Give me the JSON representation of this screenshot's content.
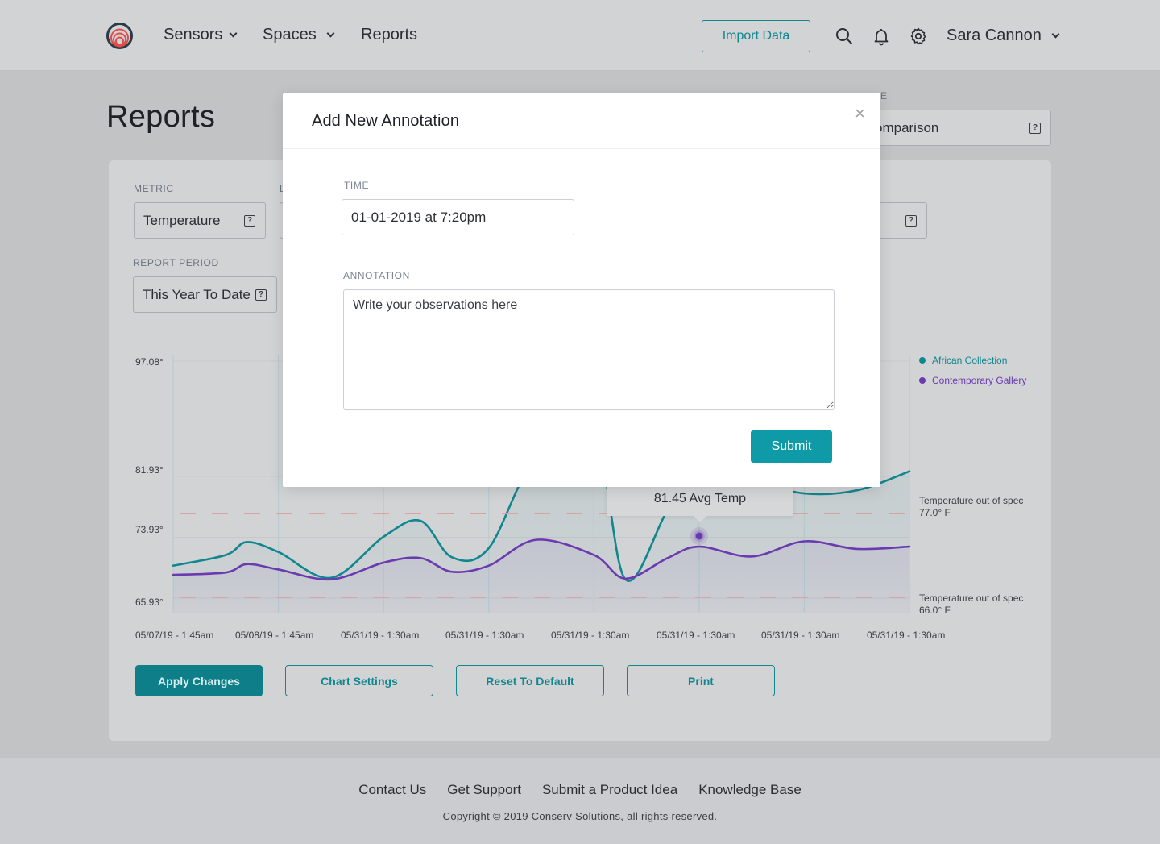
{
  "header": {
    "nav": [
      {
        "label": "Sensors",
        "has_dropdown": true
      },
      {
        "label": "Spaces",
        "has_dropdown": true
      },
      {
        "label": "Reports",
        "has_dropdown": false
      }
    ],
    "import_label": "Import Data",
    "icons": [
      "search-icon",
      "bell-icon",
      "gear-icon"
    ],
    "user_name": "Sara Cannon"
  },
  "page": {
    "title": "Reports",
    "type_label_partial": "E",
    "type_value_partial": "omparison",
    "metric_label": "METRIC",
    "metric_value": "Temperature",
    "location_label_partial": "L",
    "report_period_label": "REPORT PERIOD",
    "report_period_value": "This Year To Date",
    "help_glyph": "?"
  },
  "chart_data": {
    "type": "line",
    "title": "",
    "xlabel": "",
    "ylabel": "",
    "y_ticks": [
      "97.08°",
      "81.93°",
      "73.93°",
      "65.93°"
    ],
    "ylim": [
      65.93,
      97.08
    ],
    "x_ticks": [
      "05/07/19 - 1:45am",
      "05/08/19 - 1:45am",
      "05/31/19 - 1:30am",
      "05/31/19 - 1:30am",
      "05/31/19 - 1:30am",
      "05/31/19 - 1:30am",
      "05/31/19 - 1:30am",
      "05/31/19 - 1:30am"
    ],
    "x": [
      0,
      0.5,
      0.7,
      1,
      1.5,
      2,
      2.35,
      2.65,
      3,
      3.45,
      4,
      4.3,
      4.7,
      5,
      5.5,
      6,
      6.5,
      7
    ],
    "series": [
      {
        "name": "African Collection",
        "color": "#10868f",
        "values": [
          70.2,
          71.6,
          73.3,
          72.0,
          68.6,
          74.0,
          76.1,
          71.3,
          72.5,
          84.5,
          87.2,
          68.4,
          77.5,
          83.0,
          81.4,
          79.7,
          80.1,
          82.6
        ]
      },
      {
        "name": "Contemporary Gallery",
        "color": "#6a3ab0",
        "values": [
          69.0,
          69.3,
          70.4,
          69.7,
          68.4,
          70.6,
          71.2,
          69.4,
          70.2,
          73.6,
          71.6,
          68.5,
          71.2,
          72.7,
          71.4,
          73.4,
          72.4,
          72.7
        ]
      }
    ],
    "thresholds": [
      {
        "label": "Temperature out of spec",
        "value_label": "77.0° F",
        "value": 77.0
      },
      {
        "label": "Temperature out of spec",
        "value_label": "66.0° F",
        "value": 66.0
      }
    ],
    "legend_position": "top-right",
    "tooltip": {
      "text": "81.45 Avg Temp",
      "series": "Contemporary Gallery",
      "x_index": 5
    }
  },
  "actions": {
    "apply": "Apply Changes",
    "chart_settings": "Chart Settings",
    "reset": "Reset To Default",
    "print": "Print"
  },
  "footer": {
    "links": [
      "Contact Us",
      "Get Support",
      "Submit a Product Idea",
      "Knowledge Base"
    ],
    "copyright": "Copyright © 2019 Conserv Solutions, all rights reserved."
  },
  "modal": {
    "title": "Add New Annotation",
    "close_glyph": "×",
    "time_label": "TIME",
    "time_value": "01-01-2019 at 7:20pm",
    "annotation_label": "ANNOTATION",
    "annotation_placeholder": "Write your observations here",
    "submit_label": "Submit"
  },
  "colors": {
    "accent": "#10868f",
    "submit": "#0e9aa6",
    "series_a": "#10868f",
    "series_b": "#6a3ab0",
    "threshold": "#d9a3a3"
  }
}
